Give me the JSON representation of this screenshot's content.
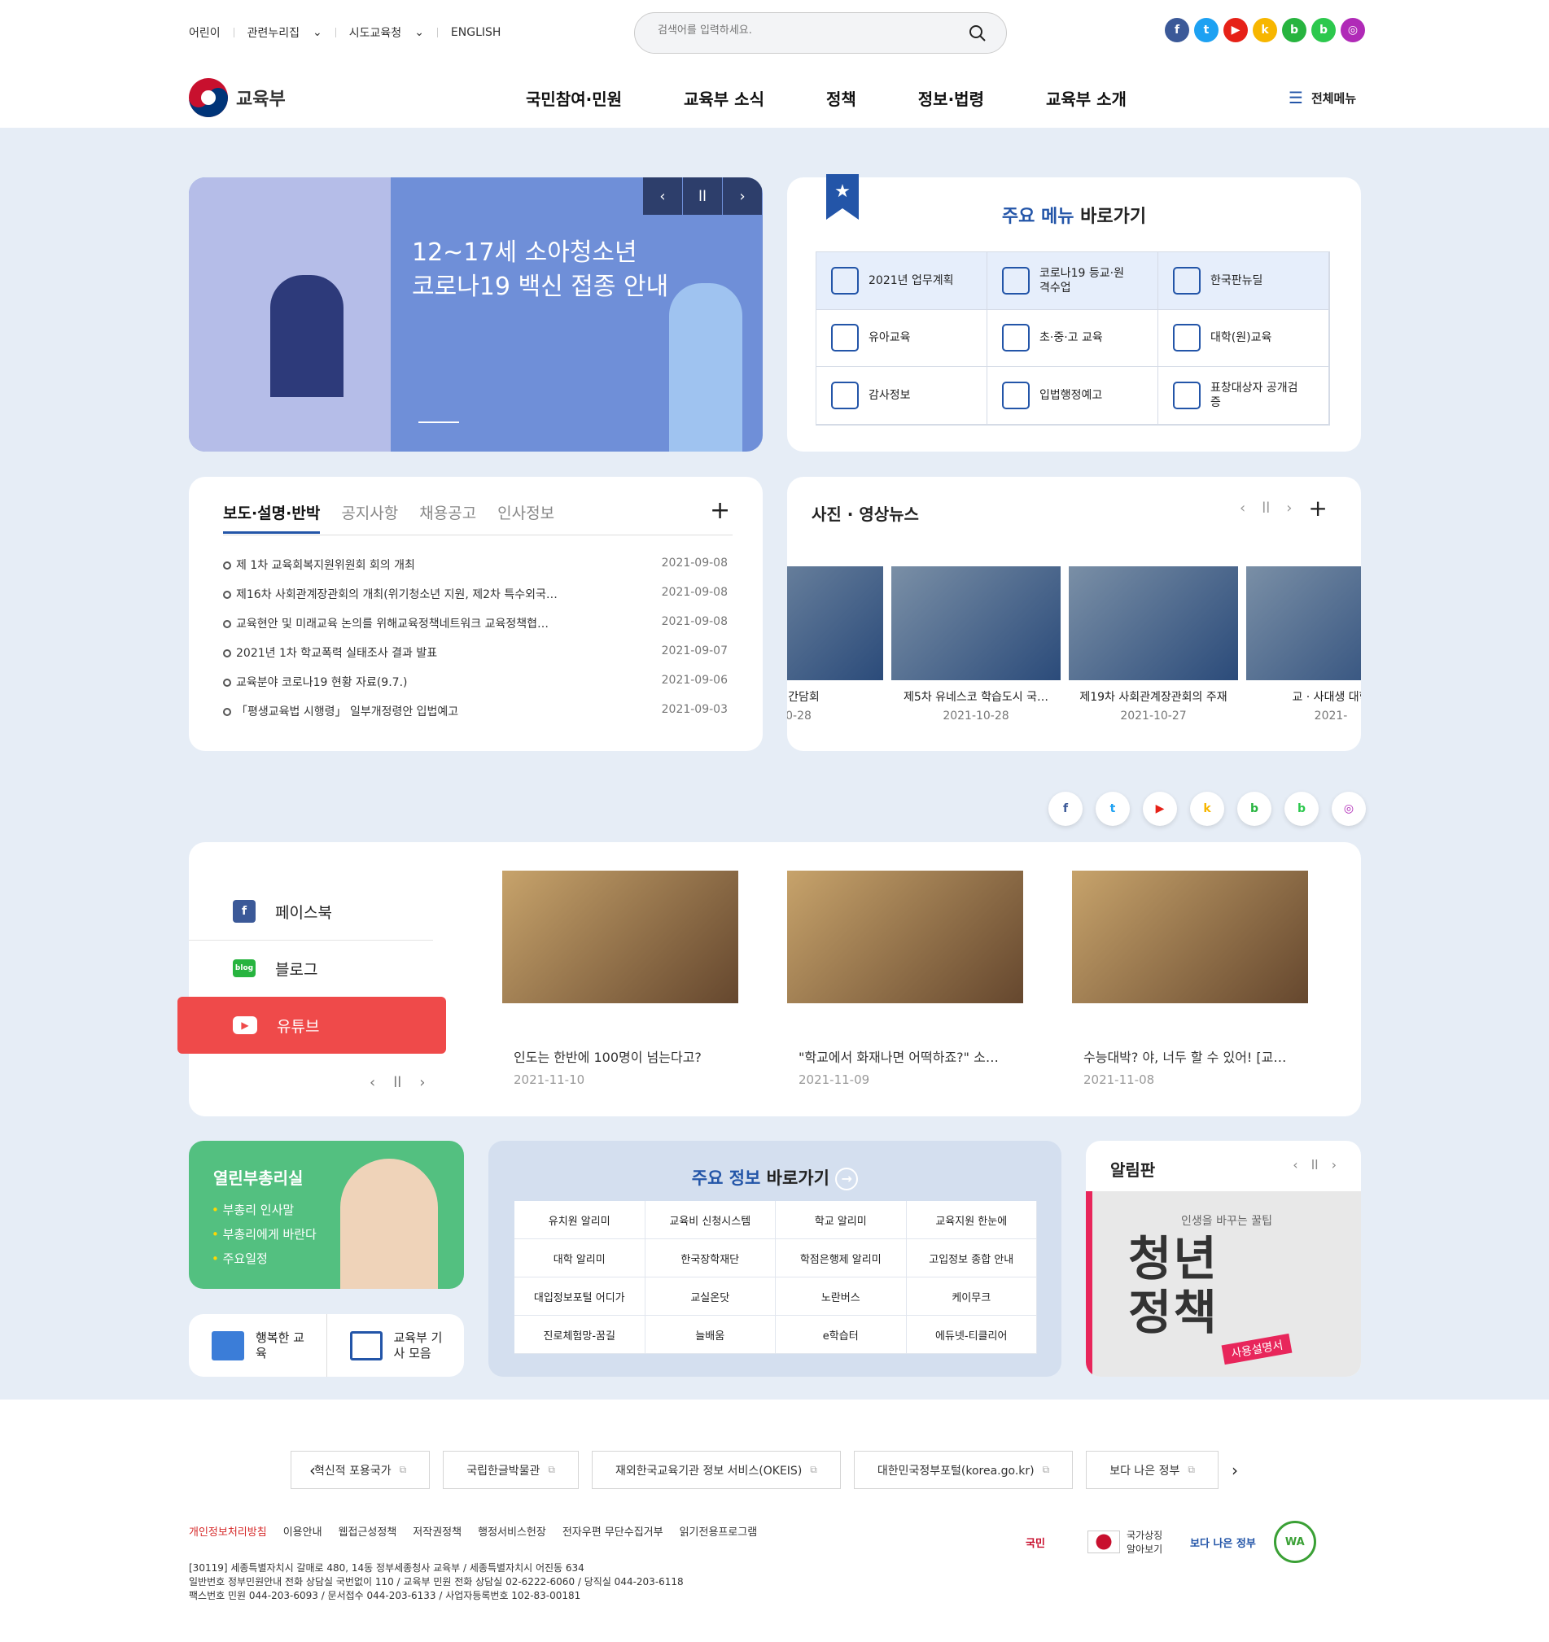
{
  "util": {
    "items": [
      "어린이",
      "관련누리집",
      "시도교육청",
      "ENGLISH"
    ]
  },
  "search": {
    "placeholder": "검색어를 입력하세요."
  },
  "sns_top": [
    {
      "name": "facebook-icon",
      "color": "#3b5998",
      "glyph": "f"
    },
    {
      "name": "twitter-icon",
      "color": "#1da1f2",
      "glyph": "t"
    },
    {
      "name": "youtube-icon",
      "color": "#e62117",
      "glyph": "▶"
    },
    {
      "name": "kakao-icon",
      "color": "#f7b600",
      "glyph": "k"
    },
    {
      "name": "blog-icon",
      "color": "#27b43f",
      "glyph": "b"
    },
    {
      "name": "band-icon",
      "color": "#2cc84d",
      "glyph": "b"
    },
    {
      "name": "instagram-icon",
      "color": "#b02ab7",
      "glyph": "◎"
    }
  ],
  "logo": {
    "text": "교육부"
  },
  "gnb": [
    "국민참여·민원",
    "교육부 소식",
    "정책",
    "정보·법령",
    "교육부 소개"
  ],
  "allmenu": "전체메뉴",
  "banner": {
    "line1": "12~17세 소아청소년",
    "line2": "코로나19 백신 접종 안내"
  },
  "quick": {
    "title_accent": "주요 메뉴",
    "title_rest": " 바로가기",
    "items": [
      "2021년 업무계획",
      "코로나19 등교·원격수업",
      "한국판뉴딜",
      "유아교육",
      "초·중·고 교육",
      "대학(원)교육",
      "감사정보",
      "입법행정예고",
      "표창대상자 공개검증"
    ]
  },
  "notice": {
    "tabs": [
      "보도·설명·반박",
      "공지사항",
      "채용공고",
      "인사정보"
    ],
    "items": [
      {
        "t": "제 1차 교육회복지원위원회 회의 개최",
        "d": "2021-09-08"
      },
      {
        "t": "제16차 사회관계장관회의 개최(위기청소년 지원, 제2차 특수외국…",
        "d": "2021-09-08"
      },
      {
        "t": "교육현안 및 미래교육 논의를 위해교육정책네트워크 교육정책협…",
        "d": "2021-09-08"
      },
      {
        "t": "2021년 1차 학교폭력 실태조사 결과 발표",
        "d": "2021-09-07"
      },
      {
        "t": "교육분야 코로나19 현황 자료(9.7.)",
        "d": "2021-09-06"
      },
      {
        "t": "「평생교육법 시행령」 일부개정령안 입법예고",
        "d": "2021-09-03"
      }
    ]
  },
  "photo": {
    "title": "사진 · 영상뉴스",
    "items": [
      {
        "c": "ㅏ간담회",
        "d": "0-28"
      },
      {
        "c": "제5차 유네스코 학습도시 국…",
        "d": "2021-10-28"
      },
      {
        "c": "제19차 사회관계장관회의 주재",
        "d": "2021-10-27"
      },
      {
        "c": "교 · 사대생 대학",
        "d": "2021-"
      }
    ]
  },
  "social": {
    "tabs": [
      "페이스북",
      "블로그",
      "유튜브"
    ],
    "videos": [
      {
        "c": "인도는 한반에 100명이 넘는다고?",
        "d": "2021-11-10"
      },
      {
        "c": "\"학교에서 화재나면 어떡하죠?\" 소…",
        "d": "2021-11-09"
      },
      {
        "c": "수능대박? 야, 너두 할 수 있어! [교…",
        "d": "2021-11-08"
      }
    ]
  },
  "pm": {
    "title": "열린부총리실",
    "items": [
      "부총리 인사말",
      "부총리에게 바란다",
      "주요일정"
    ]
  },
  "hb": [
    "행복한 교육",
    "교육부 기사 모음"
  ],
  "mi": {
    "title_accent": "주요 정보",
    "title_rest": " 바로가기",
    "items": [
      "유치원 알리미",
      "교육비 신청시스템",
      "학교 알리미",
      "교육지원 한눈에",
      "대학 알리미",
      "한국장학재단",
      "학점은행제 알리미",
      "고입정보 종합 안내",
      "대입정보포털 어디가",
      "교실온닷",
      "노란버스",
      "케이무크",
      "진로체험망-꿈길",
      "늘배움",
      "e학습터",
      "에듀넷-티클리어"
    ]
  },
  "board": {
    "title": "알림판",
    "small": "인생을 바꾸는 꿀팁",
    "big1": "청년",
    "big2": "정책",
    "tag": "사용설명서"
  },
  "links": [
    "혁신적 포용국가",
    "국립한글박물관",
    "재외한국교육기관 정보 서비스(OKEIS)",
    "대한민국정부포털(korea.go.kr)",
    "보다 나은 정부"
  ],
  "fmenu": [
    "개인정보처리방침",
    "이용안내",
    "웹접근성정책",
    "저작권정책",
    "행정서비스헌장",
    "전자우편 무단수집거부",
    "읽기전용프로그램"
  ],
  "addr": [
    "[30119] 세종특별자치시 갈매로 480, 14동 정부세종청사 교육부 / 세종특별자치시 어진동 634",
    "일반번호 정부민원안내 전화 상담실 국번없이 110 / 교육부 민원 전화 상담실 02-6222-6060 / 당직실 044-203-6118",
    "팩스번호 민원 044-203-6093 / 문서접수 044-203-6133 / 사업자등록번호 102-83-00181"
  ],
  "fbadges": {
    "gov": "국가상징 알아보기",
    "better": "보다 나은 정부",
    "wa": "WA"
  }
}
